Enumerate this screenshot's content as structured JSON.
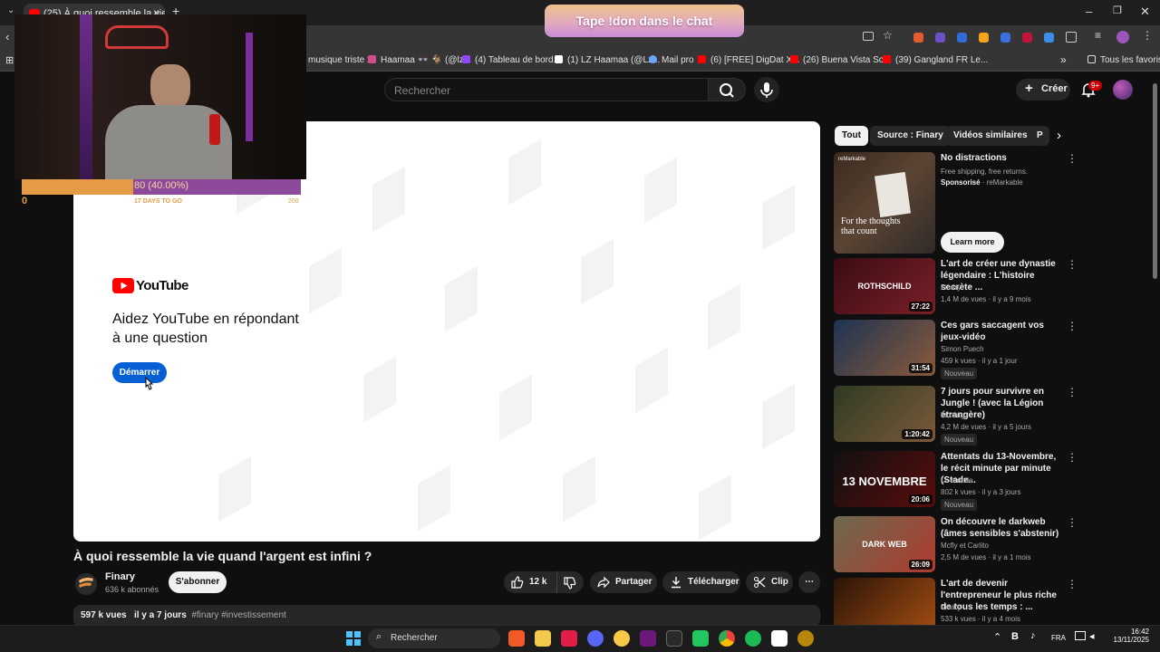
{
  "browser": {
    "tab_title": "(25) À quoi ressemble la vie qua",
    "tab_close": "×",
    "new_tab": "+",
    "bookmarks": [
      {
        "label": "musique triste 2",
        "color": "#bbbbbb"
      },
      {
        "label": "Haamaa 👓 🐐 (@lz...",
        "color": "#d14d8b"
      },
      {
        "label": "(4) Tableau de bord...",
        "color": "#9146ff"
      },
      {
        "label": "(1) LZ Haamaa (@Lz...",
        "color": "#ffffff"
      },
      {
        "label": "Mail pro",
        "color": "#6aa5ff"
      },
      {
        "label": "(6) [FREE] DigDat X...",
        "color": "#ff0000"
      },
      {
        "label": "(26) Buena Vista So...",
        "color": "#ff0000"
      },
      {
        "label": "(39) Gangland FR Le...",
        "color": "#ff0000"
      }
    ],
    "bookmarks_more": "»",
    "all_favorites": "Tous les favoris"
  },
  "overlay": {
    "chat_banner": "Tape !don dans le chat",
    "goal_text": "80 (40.00%)",
    "goal_fraction": 0.4,
    "goal_min": "0",
    "goal_days": "17 DAYS TO GO",
    "goal_max": "200"
  },
  "header": {
    "search_placeholder": "Rechercher",
    "create_label": "Créer",
    "notif_count": "9+"
  },
  "player": {
    "logo_text": "YouTube",
    "survey_question": "Aidez YouTube en répondant à une question",
    "start_label": "Démarrer"
  },
  "video": {
    "title": "À quoi ressemble la vie quand l'argent est infini ?",
    "channel": "Finary",
    "subscribers": "636 k abonnés",
    "subscribe_label": "S'abonner",
    "likes": "12 k",
    "share_label": "Partager",
    "download_label": "Télécharger",
    "clip_label": "Clip",
    "views": "597 k vues",
    "age": "il y a 7 jours",
    "hashtags": "#finary #investissement"
  },
  "chips": [
    "Tout",
    "Source : Finary",
    "Vidéos similaires",
    "P"
  ],
  "sponsored": {
    "title": "No distractions",
    "line": "Free shipping, free returns.",
    "tag": "Sponsorisé",
    "advertiser": "reMarkable",
    "cta": "Learn more",
    "thumb_caption": "For the thoughts that count",
    "thumb_brand": "reMarkable"
  },
  "recommendations": [
    {
      "title": "L'art de créer une dynastie légendaire : L'histoire secrète ...",
      "channel": "Finary",
      "meta": "1,4 M de vues · il y a 9 mois",
      "duration": "27:22",
      "badge": "",
      "thumb_text": "ROTHSCHILD",
      "colors": [
        "#3a0d12",
        "#7a1f28"
      ]
    },
    {
      "title": "Ces gars saccagent vos jeux-vidéo",
      "channel": "Simon Puech",
      "meta": "459 k vues · il y a 1 jour",
      "duration": "31:54",
      "badge": "Nouveau",
      "thumb_text": "",
      "colors": [
        "#1e3352",
        "#8a5a3a"
      ]
    },
    {
      "title": "7 jours pour survivre en Jungle ! (avec la Légion étrangère)",
      "channel": "Inoxtag",
      "meta": "4,2 M de vues · il y a 5 jours",
      "duration": "1:20:42",
      "badge": "Nouveau",
      "thumb_text": "",
      "colors": [
        "#2d3a22",
        "#7b5a3a"
      ]
    },
    {
      "title": "Attentats du 13-Novembre, le récit minute par minute (Stade...",
      "channel": "Le Monde",
      "meta": "802 k vues · il y a 3 jours",
      "duration": "20:06",
      "badge": "Nouveau",
      "thumb_text": "13 NOVEMBRE",
      "colors": [
        "#111111",
        "#5a0c0c"
      ]
    },
    {
      "title": "On découvre le darkweb (âmes sensibles s'abstenir)",
      "channel": "Mcfly et Carlito",
      "meta": "2,5 M de vues · il y a 1 mois",
      "duration": "26:09",
      "badge": "",
      "thumb_text": "DARK WEB",
      "colors": [
        "#6c6a4f",
        "#b03a2e"
      ]
    },
    {
      "title": "L'art de devenir l'entrepreneur le plus riche de tous les temps : ...",
      "channel": "Finary",
      "meta": "533 k vues · il y a 4 mois",
      "duration": "",
      "badge": "",
      "thumb_text": "",
      "colors": [
        "#2a1408",
        "#a44d12"
      ]
    }
  ],
  "taskbar": {
    "search_label": "Rechercher",
    "lang": "FRA",
    "time": "16:42",
    "date": "13/11/2025"
  }
}
